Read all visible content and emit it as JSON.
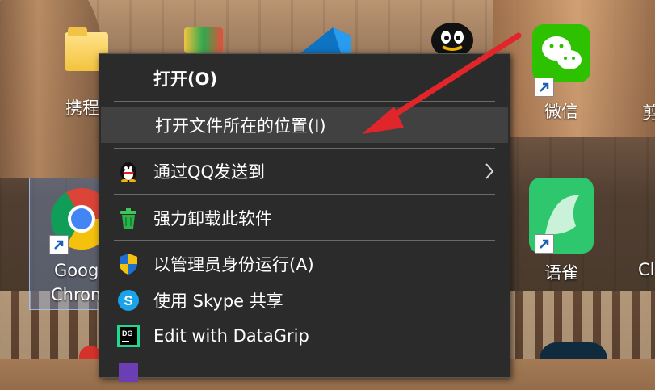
{
  "desktop": {
    "icons": {
      "folder_label": "携程",
      "chrome_label_1": "Goog",
      "chrome_label_2": "Chrom",
      "wechat_label": "微信",
      "yuque_label": "语雀",
      "right_edge_label_1": "剪",
      "right_edge_label_2": "Cl"
    }
  },
  "context_menu": {
    "items": [
      {
        "label": "打开(O)",
        "icon": "none",
        "bold": true
      },
      {
        "label": "打开文件所在的位置(I)",
        "icon": "none",
        "hover": true
      },
      {
        "label": "通过QQ发送到",
        "icon": "qq-penguin-icon",
        "submenu": true
      },
      {
        "label": "强力卸载此软件",
        "icon": "trash-can-icon"
      },
      {
        "label": "以管理员身份运行(A)",
        "icon": "uac-shield-icon"
      },
      {
        "label": "使用 Skype 共享",
        "icon": "skype-icon"
      },
      {
        "label": "Edit with DataGrip",
        "icon": "datagrip-icon"
      }
    ]
  },
  "colors": {
    "menu_bg": "#2b2b2b",
    "menu_hover": "#414141",
    "annotation_arrow": "#e0252b"
  }
}
